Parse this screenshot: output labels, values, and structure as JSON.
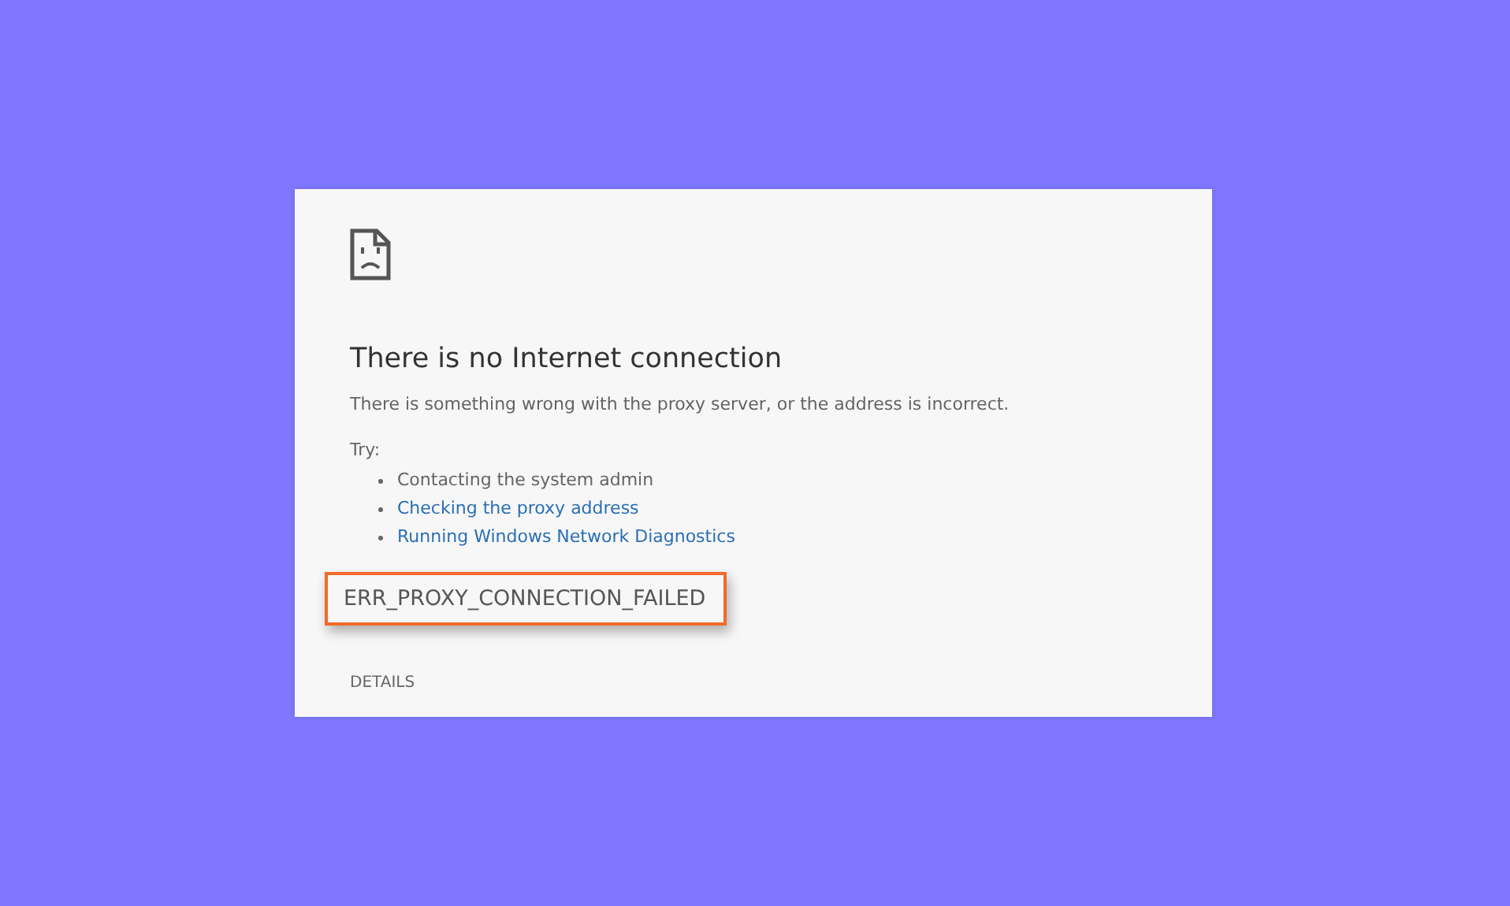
{
  "page": {
    "title": "There is no Internet connection",
    "message": "There is something wrong with the proxy server, or the address is incorrect.",
    "try_label": "Try:",
    "suggestions": [
      {
        "kind": "text",
        "label": "Contacting the system admin"
      },
      {
        "kind": "link",
        "label": "Checking the proxy address"
      },
      {
        "kind": "link",
        "label": "Running Windows Network Diagnostics"
      }
    ],
    "error_code": {
      "label": "ERR_PROXY_CONNECTION_FAILED",
      "highlighted": true
    },
    "details_button": "DETAILS"
  }
}
